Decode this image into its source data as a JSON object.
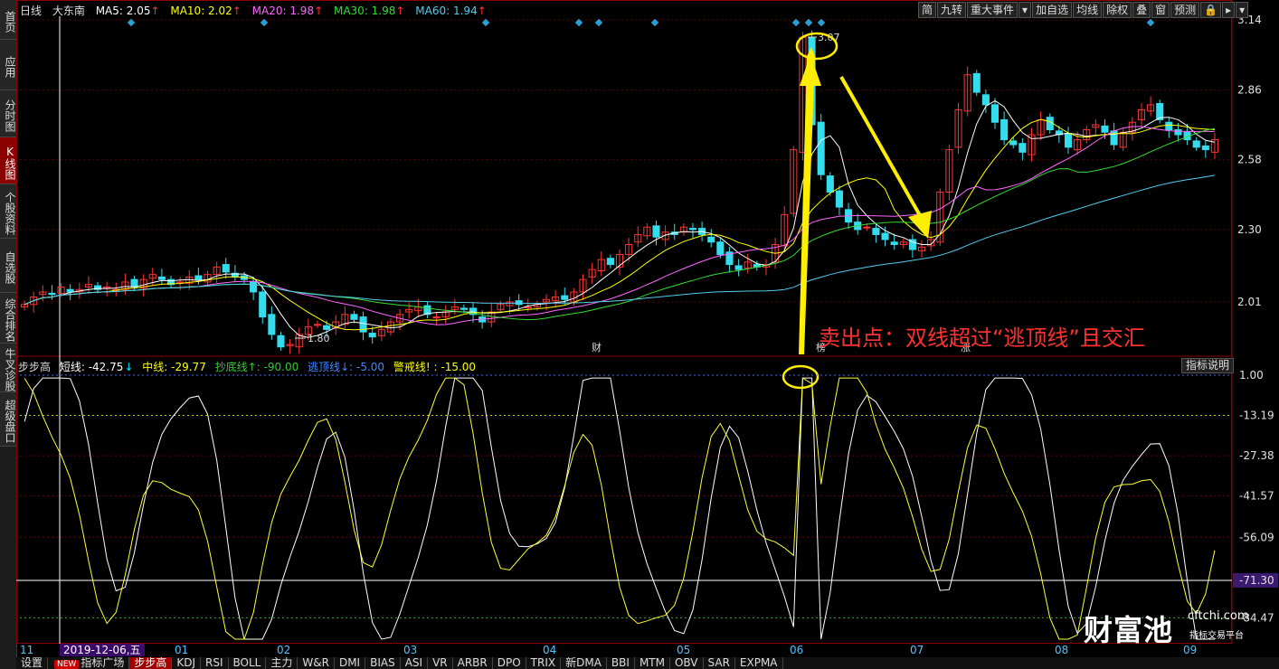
{
  "sidebar": {
    "tabs": [
      "首页",
      "应用",
      "分时图",
      "K线图",
      "个股资料",
      "自选股",
      "综合排名",
      "牛叉诊股",
      "超级盘口"
    ],
    "active": "K线图"
  },
  "header": {
    "period": "日线",
    "stock_name": "大东南",
    "ma5": "MA5: 2.05",
    "ma10": "MA10: 2.02",
    "ma20": "MA20: 1.98",
    "ma30": "MA30: 1.98",
    "ma60": "MA60: 1.94",
    "colors": {
      "ma5": "#ffffff",
      "ma10": "#ffff00",
      "ma20": "#ff66ff",
      "ma30": "#33dd33",
      "ma60": "#55ccee"
    }
  },
  "toolbar": [
    "简",
    "九转",
    "重大事件",
    "▾",
    "加自选",
    "均线",
    "除权",
    "叠",
    "窗",
    "预测",
    "🔒",
    "▸",
    "▾"
  ],
  "price_axis": [
    "3.14",
    "2.86",
    "2.58",
    "2.30",
    "2.01"
  ],
  "price_labels": {
    "high": "3.07",
    "low": "1.80"
  },
  "event_labels": [
    "财",
    "榜",
    "涨"
  ],
  "indicator": {
    "name": "步步高",
    "short": "短线: -42.75",
    "mid": "中线: -29.77",
    "bottom_line": "抄底线↑: -90.00",
    "top_line": "逃顶线↓: -5.00",
    "warn_line": "警戒线! : -15.00",
    "help": "指标说明",
    "axis": [
      "1.00",
      "-13.19",
      "-27.38",
      "-41.57",
      "-56.09",
      "-71.30",
      "-84.47"
    ],
    "highlight_value": "-71.30"
  },
  "annotation": "卖出点：双线超过“逃顶线”且交汇",
  "date_axis": {
    "current": "2019-12-06,五",
    "months": [
      "11",
      "01",
      "02",
      "03",
      "04",
      "05",
      "06",
      "07",
      "08",
      "09"
    ]
  },
  "bottom_tabs": [
    "设置",
    "指标广场",
    "步步高",
    "KDJ",
    "RSI",
    "BOLL",
    "主力",
    "W&R",
    "DMI",
    "BIAS",
    "ASI",
    "VR",
    "ARBR",
    "DPO",
    "TRIX",
    "新DMA",
    "BBI",
    "MTM",
    "OBV",
    "SAR",
    "EXPMA"
  ],
  "bottom_active": "步步高",
  "new_badge": "NEW",
  "watermark": {
    "logo": "财富池",
    "site": "cftchi.com",
    "slogan": "指标交易平台"
  },
  "chart_data": {
    "type": "candlestick",
    "ylim": [
      1.8,
      3.14
    ],
    "close": [
      2.0,
      2.03,
      2.05,
      2.04,
      2.07,
      2.05,
      2.06,
      2.08,
      2.06,
      2.07,
      2.06,
      2.09,
      2.07,
      2.1,
      2.12,
      2.1,
      2.08,
      2.09,
      2.11,
      2.1,
      2.12,
      2.15,
      2.13,
      2.11,
      2.1,
      2.05,
      1.95,
      1.88,
      1.83,
      1.84,
      1.88,
      1.91,
      1.92,
      1.9,
      1.93,
      1.96,
      1.94,
      1.89,
      1.87,
      1.9,
      1.93,
      1.96,
      1.98,
      1.99,
      1.96,
      1.95,
      1.97,
      1.99,
      1.98,
      1.96,
      1.93,
      1.97,
      2.0,
      2.01,
      2.0,
      1.99,
      2.0,
      2.02,
      2.03,
      2.02,
      2.05,
      2.1,
      2.14,
      2.18,
      2.16,
      2.2,
      2.24,
      2.28,
      2.31,
      2.27,
      2.29,
      2.28,
      2.31,
      2.3,
      2.28,
      2.25,
      2.2,
      2.16,
      2.14,
      2.17,
      2.15,
      2.16,
      2.24,
      2.36,
      2.62,
      3.07,
      2.72,
      2.52,
      2.45,
      2.39,
      2.33,
      2.3,
      2.31,
      2.28,
      2.26,
      2.24,
      2.25,
      2.22,
      2.23,
      2.26,
      2.45,
      2.62,
      2.78,
      2.92,
      2.85,
      2.8,
      2.73,
      2.66,
      2.64,
      2.61,
      2.68,
      2.74,
      2.7,
      2.68,
      2.63,
      2.66,
      2.7,
      2.72,
      2.69,
      2.64,
      2.69,
      2.73,
      2.78,
      2.8,
      2.74,
      2.7,
      2.68,
      2.66,
      2.63,
      2.62,
      2.66
    ]
  }
}
